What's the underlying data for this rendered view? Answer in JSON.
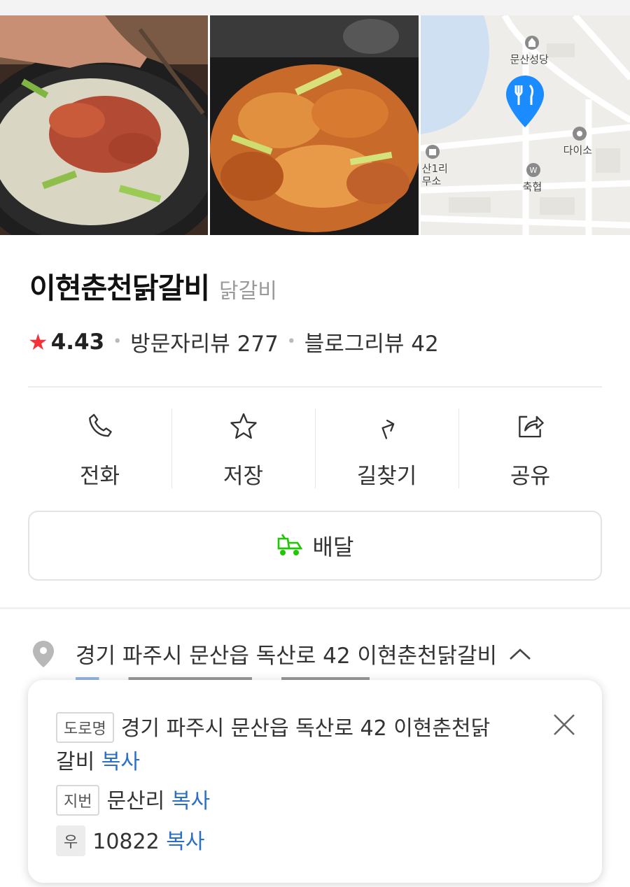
{
  "photos": [
    "food-photo-1",
    "food-photo-2"
  ],
  "map": {
    "labels": {
      "cathedral": "문산성당",
      "daiso": "다이소",
      "office_line1": "산1리",
      "office_line2": "무소",
      "coop": "축협"
    },
    "pin_color": "#1a8cff"
  },
  "place": {
    "name": "이현춘천닭갈비",
    "category": "닭갈비",
    "rating": "4.43",
    "visitor_reviews": "방문자리뷰 277",
    "blog_reviews": "블로그리뷰 42"
  },
  "actions": [
    {
      "label": "전화",
      "icon": "phone-icon"
    },
    {
      "label": "저장",
      "icon": "star-icon"
    },
    {
      "label": "길찾기",
      "icon": "directions-icon"
    },
    {
      "label": "공유",
      "icon": "share-icon"
    }
  ],
  "delivery": {
    "label": "배달",
    "icon": "delivery-truck-icon",
    "icon_color": "#1ec800"
  },
  "address": {
    "summary": "경기 파주시 문산읍 독산로 42 이현춘천닭갈비",
    "popup": {
      "road_tag": "도로명",
      "road_line1": "경기 파주시 문산읍 독산로 42 이현춘천닭",
      "road_line2": "갈비",
      "jibun_tag": "지번",
      "jibun": "문산리",
      "zip_tag": "우",
      "zip": "10822",
      "copy_label": "복사"
    }
  },
  "colors": {
    "accent_blue": "#2a6fc9",
    "star_red": "#f5323c"
  }
}
